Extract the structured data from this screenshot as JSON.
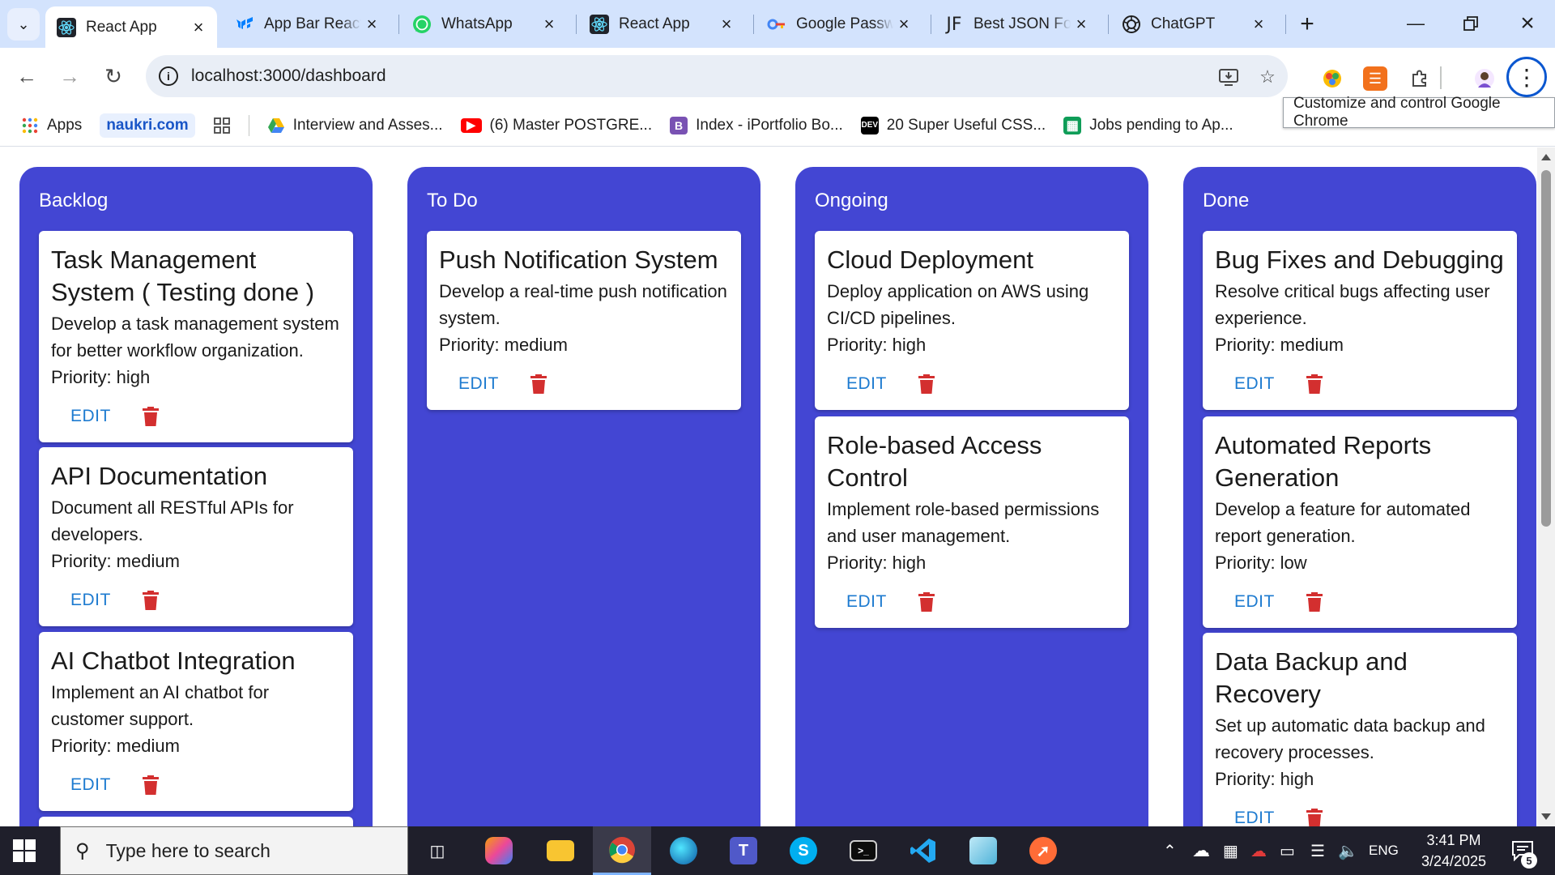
{
  "browser": {
    "tabs": [
      {
        "title": "React App",
        "favicon": "react-icon",
        "active": true
      },
      {
        "title": "App Bar React",
        "favicon": "mui-icon",
        "active": false
      },
      {
        "title": "WhatsApp",
        "favicon": "whatsapp-icon",
        "active": false
      },
      {
        "title": "React App",
        "favicon": "react-icon",
        "active": false
      },
      {
        "title": "Google Passw",
        "favicon": "google-password-icon",
        "active": false
      },
      {
        "title": "Best JSON For",
        "favicon": "jf-icon",
        "active": false
      },
      {
        "title": "ChatGPT",
        "favicon": "chatgpt-icon",
        "active": false
      }
    ],
    "url": "localhost:3000/dashboard",
    "tooltip": "Customize and control Google Chrome",
    "bookmarks": [
      {
        "label": "Apps",
        "icon": "apps-grid-icon"
      },
      {
        "label": "naukri.com",
        "icon": "naukri-icon"
      },
      {
        "label": "",
        "icon": "bookmark-grid-icon"
      },
      {
        "label": "Interview and Asses...",
        "icon": "google-drive-icon"
      },
      {
        "label": "(6) Master POSTGRE...",
        "icon": "youtube-icon"
      },
      {
        "label": "Index - iPortfolio Bo...",
        "icon": "bootstrap-icon"
      },
      {
        "label": "20 Super Useful CSS...",
        "icon": "dev-icon"
      },
      {
        "label": "Jobs pending to Ap...",
        "icon": "google-sheets-icon"
      }
    ]
  },
  "board": {
    "columns": [
      {
        "title": "Backlog",
        "cards": [
          {
            "title": "Task Management System ( Testing done )",
            "description": "Develop a task management system for better workflow organization.",
            "priority": "Priority: high",
            "edit": "EDIT"
          },
          {
            "title": "API Documentation",
            "description": "Document all RESTful APIs for developers.",
            "priority": "Priority: medium",
            "edit": "EDIT"
          },
          {
            "title": "AI Chatbot Integration",
            "description": "Implement an AI chatbot for customer support.",
            "priority": "Priority: medium",
            "edit": "EDIT"
          }
        ]
      },
      {
        "title": "To Do",
        "cards": [
          {
            "title": "Push Notification System",
            "description": "Develop a real-time push notification system.",
            "priority": "Priority: medium",
            "edit": "EDIT"
          }
        ]
      },
      {
        "title": "Ongoing",
        "cards": [
          {
            "title": "Cloud Deployment",
            "description": "Deploy application on AWS using CI/CD pipelines.",
            "priority": "Priority: high",
            "edit": "EDIT"
          },
          {
            "title": "Role-based Access Control",
            "description": "Implement role-based permissions and user management.",
            "priority": "Priority: high",
            "edit": "EDIT"
          }
        ]
      },
      {
        "title": "Done",
        "cards": [
          {
            "title": "Bug Fixes and Debugging",
            "description": "Resolve critical bugs affecting user experience.",
            "priority": "Priority: medium",
            "edit": "EDIT"
          },
          {
            "title": "Automated Reports Generation",
            "description": "Develop a feature for automated report generation.",
            "priority": "Priority: low",
            "edit": "EDIT"
          },
          {
            "title": "Data Backup and Recovery",
            "description": "Set up automatic data backup and recovery processes.",
            "priority": "Priority: high",
            "edit": "EDIT"
          }
        ]
      }
    ],
    "colors": {
      "column_bg": "#4346d3",
      "edit_text": "#1e7bd0",
      "delete_icon": "#d32f2f"
    }
  },
  "taskbar": {
    "search_placeholder": "Type here to search",
    "apps": [
      "task-view-icon",
      "copilot-icon",
      "file-explorer-icon",
      "chrome-icon",
      "edge-icon",
      "teams-icon",
      "skype-icon",
      "terminal-icon",
      "vscode-icon",
      "notepad-icon",
      "postman-icon"
    ],
    "language": "ENG",
    "time": "3:41 PM",
    "date": "3/24/2025",
    "notification_count": "5"
  }
}
